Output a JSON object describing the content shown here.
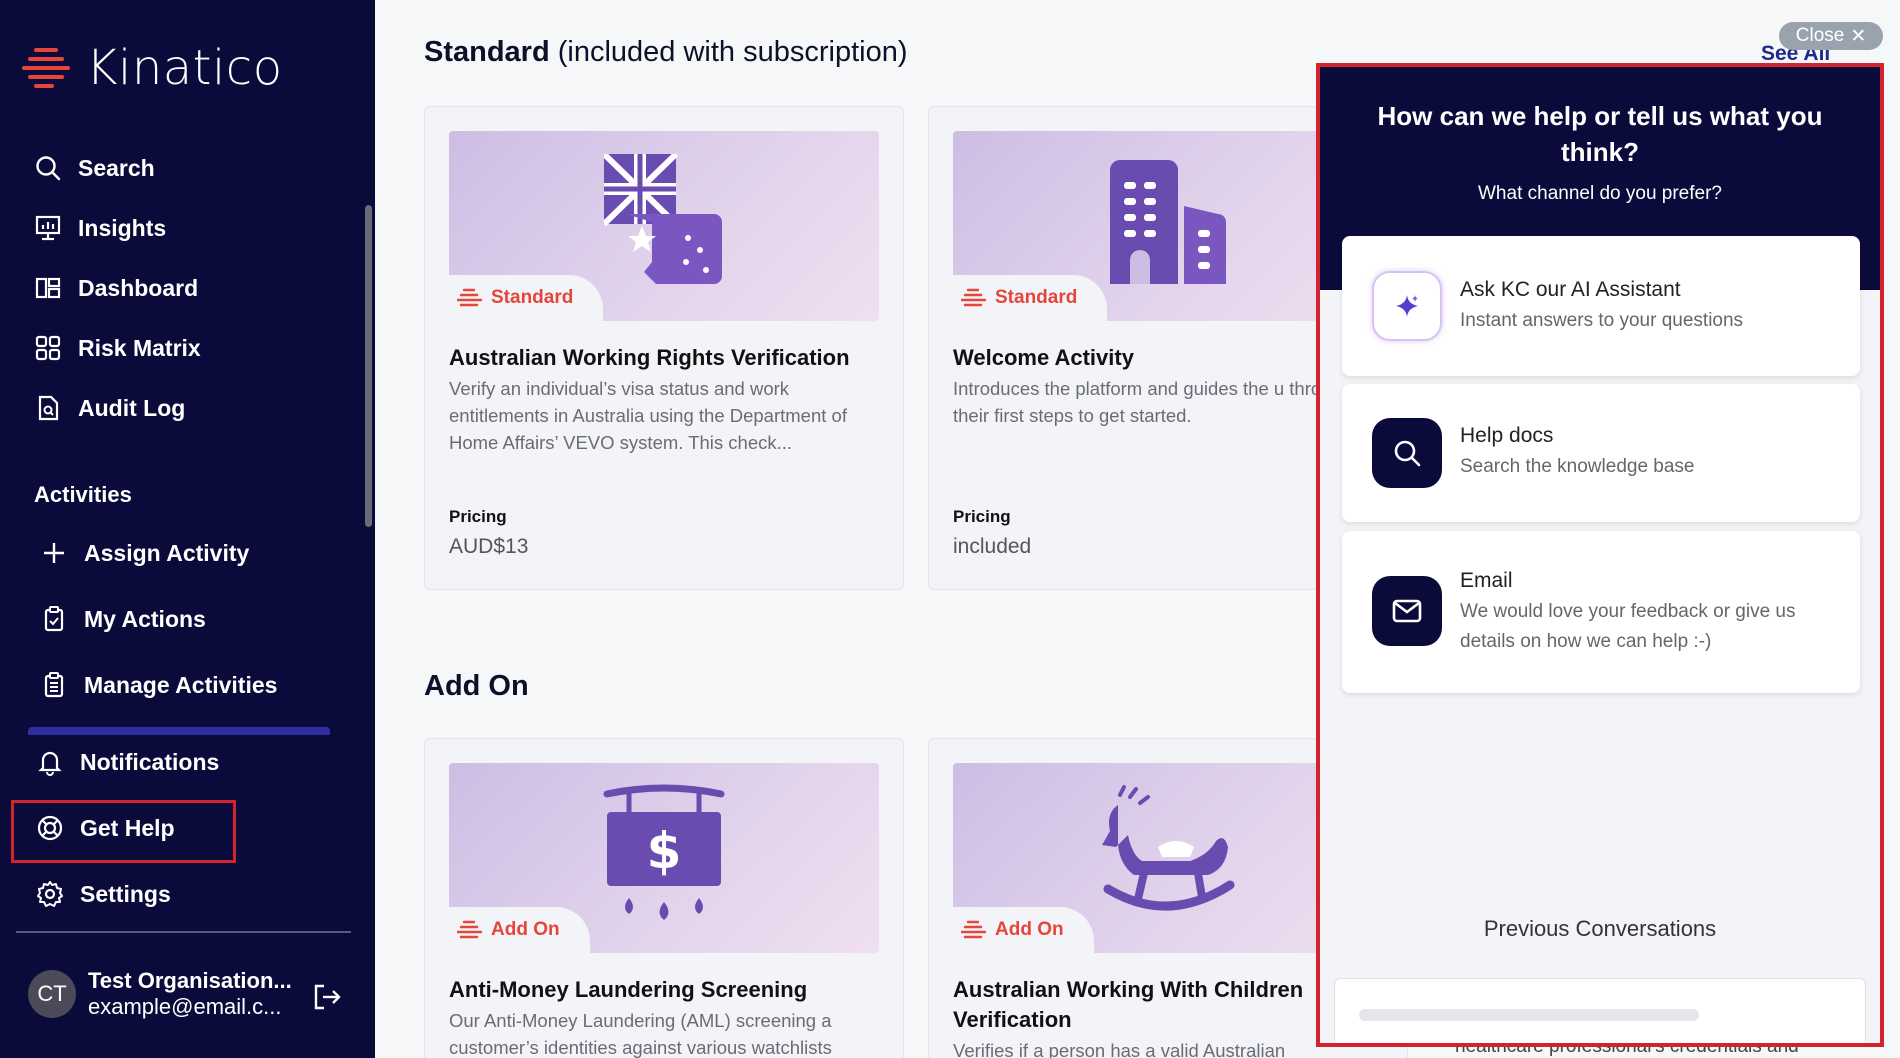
{
  "app": {
    "logo_text": "Kinatico"
  },
  "sidebar": {
    "items": [
      {
        "label": "Search",
        "icon": "search-icon"
      },
      {
        "label": "Insights",
        "icon": "insights-icon"
      },
      {
        "label": "Dashboard",
        "icon": "dashboard-icon"
      },
      {
        "label": "Risk Matrix",
        "icon": "grid-icon"
      },
      {
        "label": "Audit Log",
        "icon": "audit-log-icon"
      }
    ],
    "activities_title": "Activities",
    "activity_items": [
      {
        "label": "Assign Activity",
        "icon": "plus-icon"
      },
      {
        "label": "My Actions",
        "icon": "clipboard-icon"
      },
      {
        "label": "Manage Activities",
        "icon": "clipboard-list-icon"
      }
    ],
    "bottom_items": [
      {
        "label": "Notifications",
        "icon": "bell-icon"
      },
      {
        "label": "Get Help",
        "icon": "lifebuoy-icon"
      },
      {
        "label": "Settings",
        "icon": "gear-icon"
      }
    ],
    "user": {
      "initials": "CT",
      "name": "Test Organisation...",
      "email": "example@email.c..."
    }
  },
  "main": {
    "standard_heading": "Standard",
    "standard_heading_suffix": " (included with subscription)",
    "see_all": "See All",
    "close_label": "Close",
    "addon_heading": "Add On",
    "pricing_label": "Pricing",
    "cards": [
      {
        "tag": "Standard",
        "title": "Australian Working Rights Verification",
        "description": "Verify an individual’s visa status and work entitlements in Australia using the Department of Home Affairs’ VEVO system. This check...",
        "price": "AUD$13",
        "icon": "australia-flag-icon"
      },
      {
        "tag": "Standard",
        "title": "Welcome Activity",
        "description": "Introduces the platform and guides the u through their first steps to get started.",
        "price": "included",
        "icon": "building-icon"
      },
      {
        "tag": "Add On",
        "title": "Anti-Money Laundering Screening",
        "description": "Our Anti-Money Laundering (AML) screening a customer’s identities against various watchlists",
        "icon": "money-sign-icon"
      },
      {
        "tag": "Add On",
        "title": "Australian Working With Children Verification",
        "description": "Verifies if a person has a valid Australian",
        "icon": "rocking-horse-icon"
      }
    ]
  },
  "help_panel": {
    "title": "How can we help or tell us what you think?",
    "subtitle": "What channel do you prefer?",
    "options": [
      {
        "title": "Ask KC our AI Assistant",
        "description": "Instant answers to your questions",
        "icon": "sparkle-icon"
      },
      {
        "title": "Help docs",
        "description": "Search the knowledge base",
        "icon": "search-icon"
      },
      {
        "title": "Email",
        "description": "We would love your feedback or give us details on how we can help :-)",
        "icon": "mail-icon"
      }
    ],
    "previous_title": "Previous Conversations",
    "behind_text": "healthcare professional's credentials and"
  },
  "colors": {
    "sidebar_bg": "#0b0b3b",
    "accent_orange": "#e5453b",
    "highlight_red": "#d3242d"
  }
}
